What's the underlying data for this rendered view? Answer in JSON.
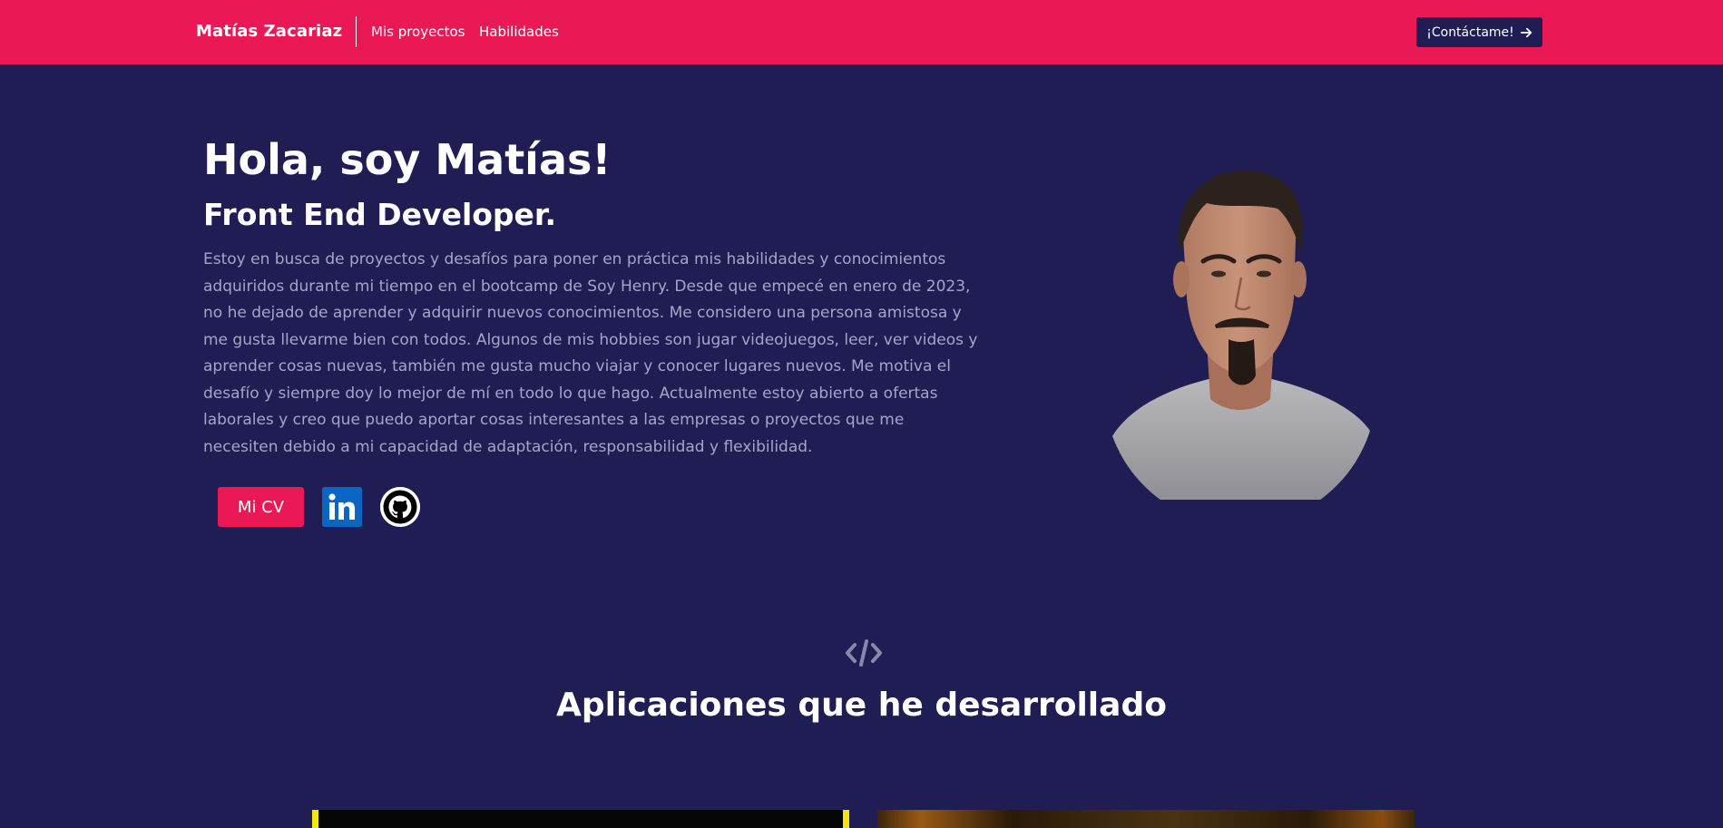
{
  "header": {
    "brand": "Matías Zacariaz",
    "nav": [
      {
        "label": "Mis proyectos"
      },
      {
        "label": "Habilidades"
      }
    ],
    "contact_label": "¡Contáctame!",
    "contact_icon": "arrow-right-icon",
    "background": "#ea1955"
  },
  "hero": {
    "title": "Hola, soy Matías!",
    "subtitle": "Front End Developer.",
    "bio": "Estoy en busca de proyectos y desafíos para poner en práctica mis habilidades y conocimientos adquiridos durante mi tiempo en el bootcamp de Soy Henry. Desde que empecé en enero de 2023, no he dejado de aprender y adquirir nuevos conocimientos. Me considero una persona amistosa y me gusta llevarme bien con todos. Algunos de mis hobbies son jugar videojuegos, leer, ver videos y aprender cosas nuevas, también me gusta mucho viajar y conocer lugares nuevos. Me motiva el desafío y siempre doy lo mejor de mí en todo lo que hago. Actualmente estoy abierto a ofertas laborales y creo que puedo aportar cosas interesantes a las empresas o proyectos que me necesiten debido a mi capacidad de adaptación, responsabilidad y flexibilidad.",
    "cv_label": "Mi CV",
    "social_icons": [
      "linkedin-icon",
      "github-icon"
    ]
  },
  "projects": {
    "icon": "code-icon",
    "title": "Aplicaciones que he desarrollado"
  },
  "colors": {
    "background": "#201c54",
    "accent": "#ea1955",
    "text_muted": "#a7a5c7"
  }
}
